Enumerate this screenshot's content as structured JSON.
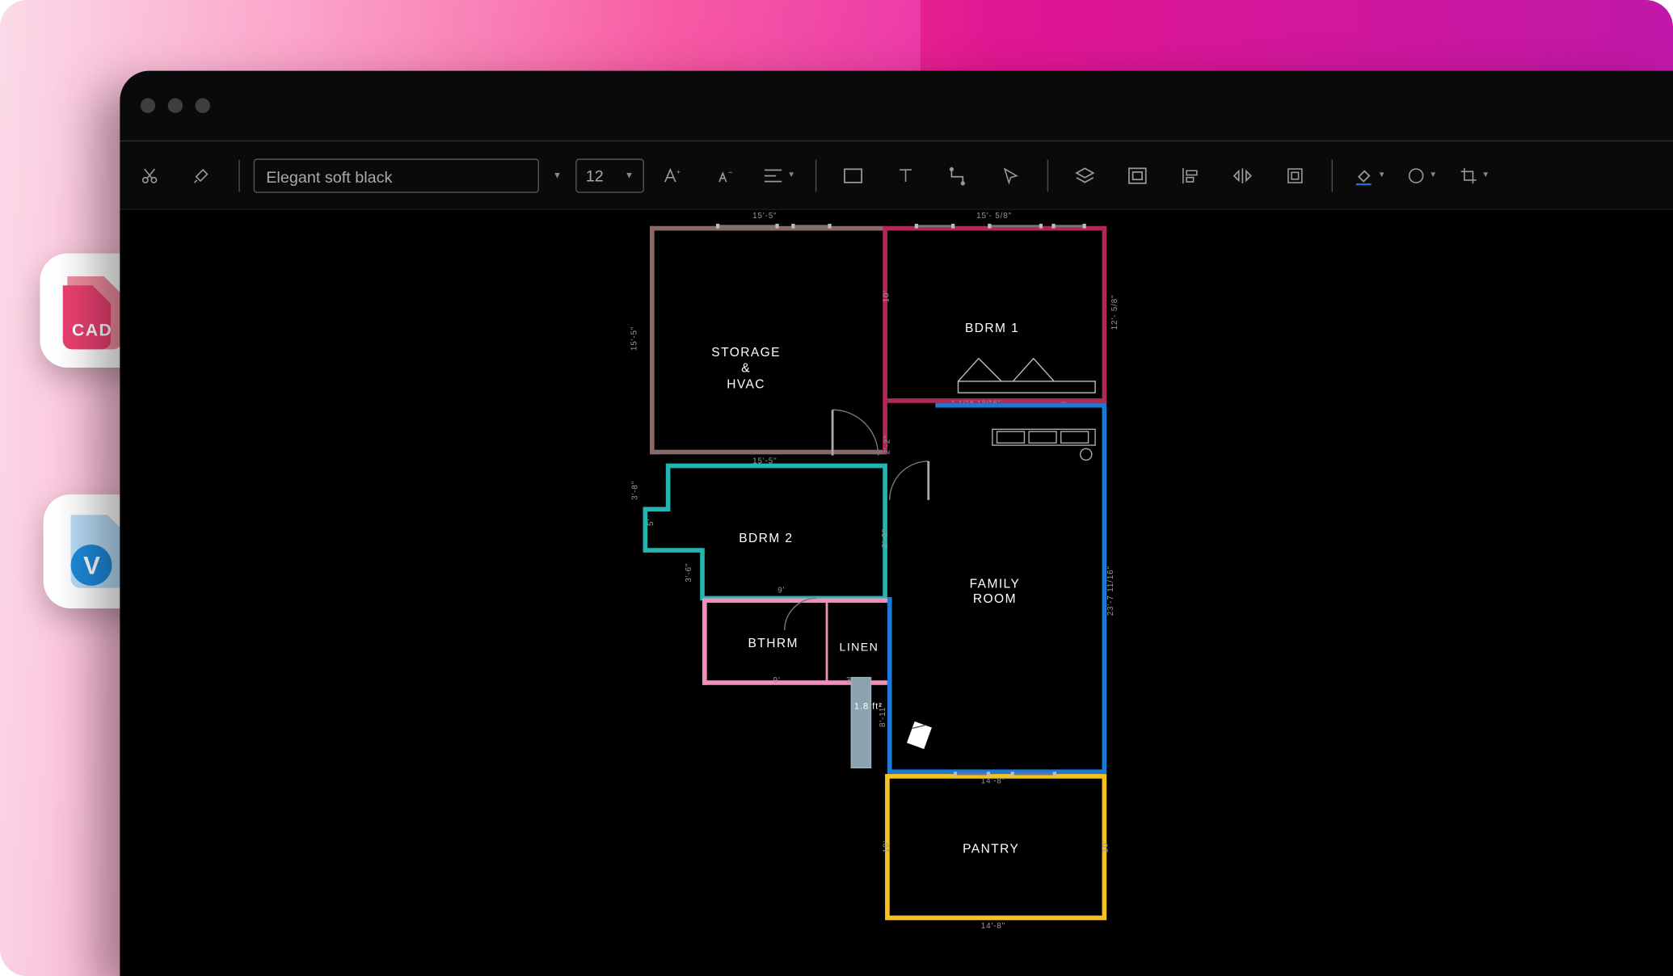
{
  "toolbar": {
    "font_name": "Elegant soft black",
    "font_size": "12"
  },
  "rooms": {
    "storage": "STORAGE\n&\nHVAC",
    "bdrm1": "BDRM 1",
    "bdrm2": "BDRM 2",
    "bthrm": "BTHRM",
    "linen": "LINEN",
    "family": "FAMILY\nROOM",
    "pantry": "PANTRY"
  },
  "dims": {
    "storage_top": "15'-5\"",
    "bdrm1_top": "15'- 5/8\"",
    "storage_left": "15'-5\"",
    "storage_bottom": "15'-5\"",
    "bdrm1_right": "12'- 5/8\"",
    "bdrm2_d1": "3'-8\"",
    "bdrm2_d2": "3'-6\"",
    "bdrm2_d3": "5'",
    "bdrm2_b": "9'",
    "bdrm2_r": "8'-9\"",
    "bthrm_b": "9'",
    "linen_b": "3'-6\"",
    "family_right": "23'-7 11/16\"",
    "family_kitchen_l": "8'-11\"",
    "hallway": "2'-2\"",
    "pantry_top": "14'-8\"",
    "pantry_bottom": "14'-8\"",
    "pantry_r": "10'",
    "pantry_l": "10'",
    "bdrm1_10": "10'",
    "bdrm1_7": "7'",
    "bdrm1_tiny": "1 1/16 13/16\""
  },
  "kitchen": {
    "measure": "1.8 ft²"
  },
  "badges": {
    "cad": "CAD",
    "v": "V"
  },
  "colors": {
    "storage": "#8a6a68",
    "bdrm1": "#b02a59",
    "bdrm2": "#25b5b0",
    "bthrm_linen": "#f08fb9",
    "family": "#1c79d6",
    "pantry": "#f4c321"
  }
}
